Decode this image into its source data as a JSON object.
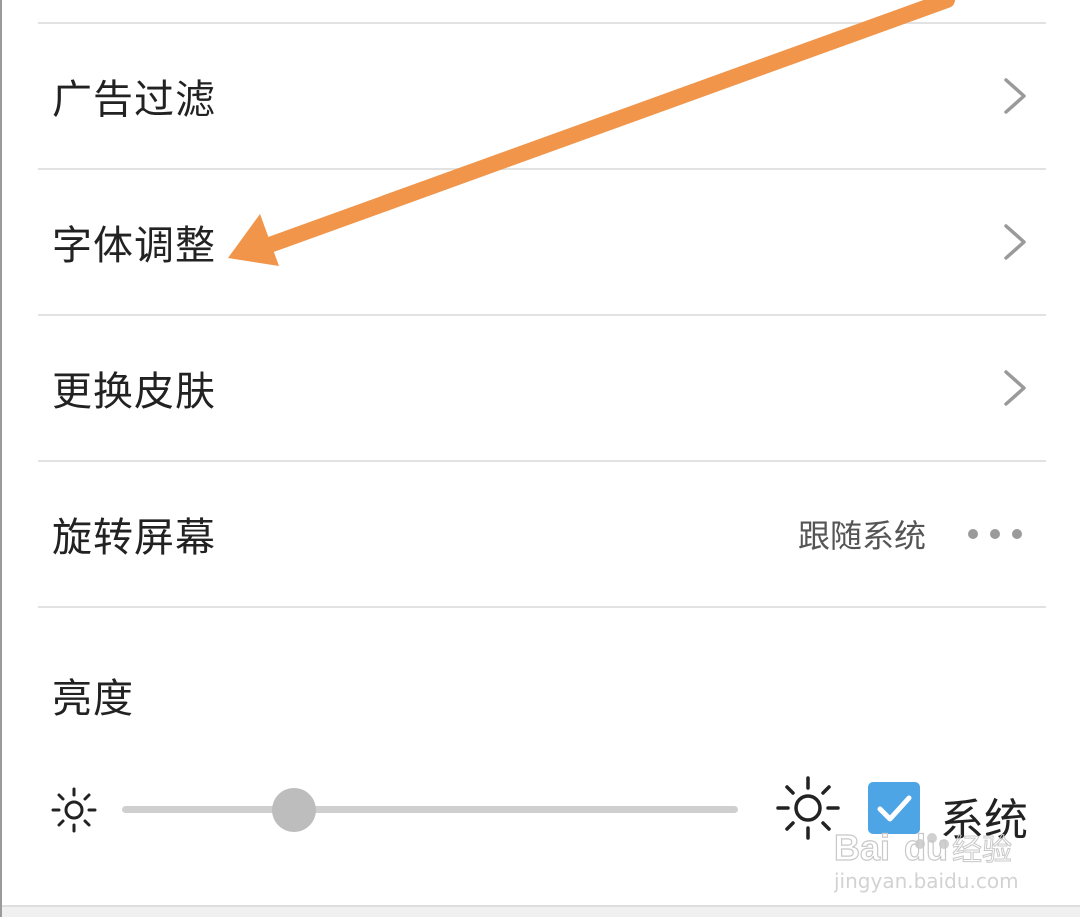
{
  "settings": {
    "items": [
      {
        "label": "广告过滤",
        "control": "chevron"
      },
      {
        "label": "字体调整",
        "control": "chevron"
      },
      {
        "label": "更换皮肤",
        "control": "chevron"
      },
      {
        "label": "旋转屏幕",
        "control": "value",
        "value": "跟随系统"
      }
    ]
  },
  "brightness": {
    "title": "亮度",
    "level": 0.28,
    "follow_system_label": "系统",
    "follow_system_checked": true
  },
  "icons": {
    "row_chevron": "chevron-right-icon",
    "more": "more-horizontal-icon",
    "brightness_low": "sun-small-icon",
    "brightness_high": "sun-large-icon",
    "checkbox": "checkbox-checked-icon"
  },
  "colors": {
    "annotation_arrow": "#f0954a",
    "checkbox_fill": "#4ea5e6",
    "slider_knob": "#bdbdbd",
    "slider_track": "#cfcfcf"
  },
  "watermark": {
    "brand": "Baidu经验",
    "url": "jingyan.baidu.com"
  }
}
